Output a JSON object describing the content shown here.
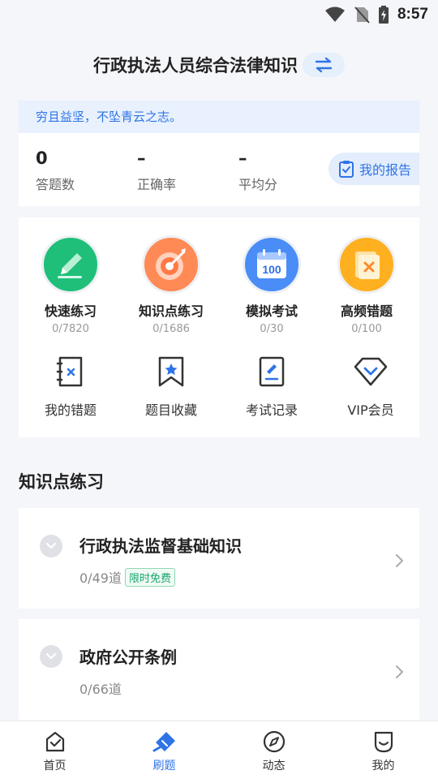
{
  "status_bar": {
    "time": "8:57"
  },
  "header": {
    "title": "行政执法人员综合法律知识",
    "switch_icon": "swap-arrows-icon"
  },
  "stats": {
    "motto": "穷且益坚，不坠青云之志。",
    "items": [
      {
        "value": "0",
        "label": "答题数"
      },
      {
        "value": "–",
        "label": "正确率"
      },
      {
        "value": "–",
        "label": "平均分"
      }
    ],
    "report_label": "我的报告"
  },
  "features": [
    {
      "label": "快速练习",
      "count": "0/7820",
      "icon": "pencil-icon",
      "color": "#1fbf7a"
    },
    {
      "label": "知识点练习",
      "count": "0/1686",
      "icon": "target-icon",
      "color": "#ff7a45"
    },
    {
      "label": "模拟考试",
      "count": "0/30",
      "icon": "calendar-100-icon",
      "color": "#3b82f6"
    },
    {
      "label": "高频错题",
      "count": "0/100",
      "icon": "wrong-note-icon",
      "color": "#ffb020"
    }
  ],
  "tools": [
    {
      "label": "我的错题",
      "icon": "wrong-book-icon"
    },
    {
      "label": "题目收藏",
      "icon": "bookmark-star-icon"
    },
    {
      "label": "考试记录",
      "icon": "exam-record-icon"
    },
    {
      "label": "VIP会员",
      "icon": "diamond-icon"
    }
  ],
  "section": {
    "title": "知识点练习"
  },
  "topics": [
    {
      "title": "行政执法监督基础知识",
      "count": "0/49道",
      "badge": "限时免费"
    },
    {
      "title": "政府公开条例",
      "count": "0/66道",
      "badge": ""
    }
  ],
  "nav": [
    {
      "label": "首页",
      "icon": "home-icon",
      "active": false
    },
    {
      "label": "刷题",
      "icon": "brush-icon",
      "active": true
    },
    {
      "label": "动态",
      "icon": "compass-icon",
      "active": false
    },
    {
      "label": "我的",
      "icon": "profile-icon",
      "active": false
    }
  ],
  "colors": {
    "accent": "#2f74e6",
    "badge_green": "#1aa56b"
  }
}
